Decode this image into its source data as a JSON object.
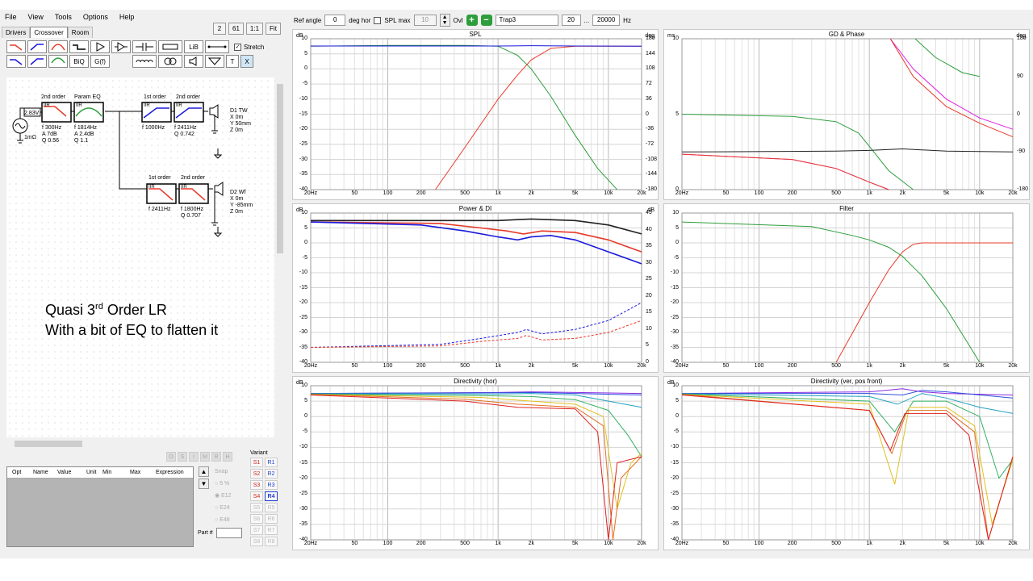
{
  "menu": [
    "File",
    "View",
    "Tools",
    "Options",
    "Help"
  ],
  "tabs": [
    "Drivers",
    "Crossover",
    "Room"
  ],
  "toolbar_right": [
    "2",
    "61",
    "1:1",
    "Fit"
  ],
  "icons": {
    "biq": "BiQ",
    "gf": "G(f)",
    "lib": "LiB",
    "t": "T",
    "x": "X"
  },
  "stretch_label": "Stretch",
  "schematic": {
    "source_voltage": "2.83V",
    "source_impedance": "1mΩ",
    "blocks": [
      {
        "header": "2nd order",
        "type": "IIR",
        "params": [
          "f  300Hz",
          "A  7dB",
          "Q  0.56"
        ]
      },
      {
        "header": "Param EQ",
        "type": "IIR",
        "params": [
          "f  1814Hz",
          "A  2.4dB",
          "Q  1.1"
        ]
      },
      {
        "header": "1st order",
        "type": "IIR",
        "params": [
          "f  1000Hz"
        ]
      },
      {
        "header": "2nd order",
        "type": "IIR",
        "params": [
          "f  2411Hz",
          "Q  0.742"
        ]
      },
      {
        "header": "1st order",
        "type": "IIR",
        "params": [
          "f  2411Hz"
        ]
      },
      {
        "header": "2nd order",
        "type": "IIR",
        "params": [
          "f  1800Hz",
          "Q  0.707"
        ]
      }
    ],
    "driver1": [
      "D1 TW",
      "X 0m",
      "Y 50mm",
      "Z 0m"
    ],
    "driver2": [
      "D2 Wf",
      "X 0m",
      "Y -85mm",
      "Z 0m"
    ]
  },
  "annotation": {
    "line1a": "Quasi 3",
    "line1sup": "rd",
    "line1b": " Order LR",
    "line2": "With a bit of EQ to flatten it"
  },
  "opt_buttons": [
    "O",
    "S",
    "I",
    "M",
    "R",
    "H"
  ],
  "table_headers": [
    "Opt",
    "Name",
    "Value",
    "Unit",
    "Min",
    "Max",
    "Expression"
  ],
  "snap": {
    "label": "Snap",
    "options": [
      "5 %",
      "E12",
      "E24",
      "E48"
    ]
  },
  "part_label": "Part #",
  "variant": {
    "label": "Variant",
    "s": [
      "S1",
      "S2",
      "S3",
      "S4",
      "S5",
      "S6",
      "S7",
      "S8"
    ],
    "r": [
      "R1",
      "R2",
      "R3",
      "R4",
      "R5",
      "R6",
      "R7",
      "R8"
    ],
    "selected": "R4"
  },
  "top_controls": {
    "ref_angle_label": "Ref angle",
    "ref_angle": "0",
    "deg_hor": "deg hor",
    "spl_max_label": "SPL max",
    "spl_max": "10",
    "ovl": "Ovl",
    "name": "Trap3",
    "fmin": "20",
    "dots": "...",
    "fmax": "20000",
    "hz": "Hz"
  },
  "x_ticks": [
    "20Hz",
    "50",
    "100",
    "200",
    "500",
    "1k",
    "2k",
    "5k",
    "10k",
    "20k"
  ],
  "colors": {
    "green": "#2e9e3c",
    "red": "#e83a2a",
    "blue": "#1a1adc",
    "black": "#222222",
    "magenta": "#e020e0",
    "grey": "#808080"
  },
  "chart_data": [
    {
      "type": "line",
      "title": "SPL",
      "ylabel_left": "dB",
      "ylabel_right": "deg",
      "ylim": [
        -40,
        10
      ],
      "yticks": [
        "10",
        "5",
        "0",
        "-5",
        "-10",
        "-15",
        "-20",
        "-25",
        "-30",
        "-35",
        "-40"
      ],
      "yticks_right": [
        "180",
        "144",
        "108",
        "72",
        "36",
        "0",
        "-36",
        "-72",
        "-108",
        "-144",
        "-180"
      ],
      "series": [
        {
          "color": "green",
          "x": [
            20,
            100,
            500,
            1000,
            1500,
            2000,
            3000,
            5000,
            8000,
            12000
          ],
          "y": [
            7.5,
            7.8,
            7.8,
            7.5,
            4.5,
            0,
            -9,
            -22,
            -33,
            -42
          ]
        },
        {
          "color": "red",
          "x": [
            270,
            500,
            1000,
            1500,
            2000,
            3000,
            5000,
            10000,
            20000
          ],
          "y": [
            -40,
            -26,
            -10,
            -2,
            3,
            6.8,
            7.5,
            7.5,
            7.5
          ]
        },
        {
          "color": "blue",
          "x": [
            20,
            1000,
            2000,
            5000,
            20000
          ],
          "y": [
            7.6,
            7.6,
            7.7,
            7.6,
            7.5
          ]
        }
      ]
    },
    {
      "type": "line",
      "title": "GD & Phase",
      "ylabel_left": "ms",
      "ylabel_right": "deg",
      "ylim": [
        -5,
        15
      ],
      "yticks": [
        "10",
        "5",
        "0"
      ],
      "yticks_right": [
        "180",
        "90",
        "0",
        "-90",
        "-180"
      ],
      "series": [
        {
          "color": "green",
          "x": [
            20,
            200,
            500,
            800,
            1100,
            1500,
            2500
          ],
          "y": [
            5,
            4.7,
            4,
            2.5,
            0,
            -2.5,
            -5
          ]
        },
        {
          "color": "green",
          "x": [
            2600,
            4000,
            7000,
            10000
          ],
          "y": [
            15,
            12.5,
            10.5,
            10
          ]
        },
        {
          "color": "black",
          "x": [
            20,
            500,
            1000,
            2000,
            5000,
            20000
          ],
          "y": [
            0,
            0.1,
            0.2,
            0.4,
            0.1,
            0
          ]
        },
        {
          "color": "magenta",
          "x": [
            20,
            200,
            500,
            1000,
            1500
          ],
          "y": [
            -0.3,
            -1,
            -2.2,
            -4,
            -5
          ]
        },
        {
          "color": "magenta",
          "x": [
            1550,
            2500,
            5000,
            10000,
            20000
          ],
          "y": [
            15,
            11,
            7,
            4.5,
            3
          ]
        },
        {
          "color": "red",
          "x": [
            20,
            200,
            500,
            1000,
            1500
          ],
          "y": [
            -0.3,
            -1,
            -2.2,
            -4,
            -5
          ]
        },
        {
          "color": "red",
          "x": [
            1550,
            2500,
            5000,
            10000,
            20000
          ],
          "y": [
            15,
            10,
            6,
            3.8,
            2
          ]
        }
      ]
    },
    {
      "type": "line",
      "title": "Power & DI",
      "ylabel_left": "dB",
      "ylabel_right": "dB",
      "ylim": [
        -40,
        10
      ],
      "yticks": [
        "10",
        "5",
        "0",
        "-5",
        "-10",
        "-15",
        "-20",
        "-25",
        "-30",
        "-35",
        "-40"
      ],
      "yticks_right": [
        "45",
        "40",
        "35",
        "30",
        "25",
        "20",
        "15",
        "10",
        "5",
        "0"
      ],
      "series": [
        {
          "color": "black",
          "x": [
            20,
            500,
            1000,
            2000,
            5000,
            10000,
            20000
          ],
          "y": [
            7.5,
            7.5,
            7.5,
            8,
            7.5,
            6,
            3
          ]
        },
        {
          "color": "red",
          "x": [
            20,
            300,
            700,
            1200,
            1700,
            2500,
            5000,
            10000,
            20000
          ],
          "y": [
            7,
            6.5,
            5,
            4,
            3,
            4,
            3.5,
            1,
            -3
          ]
        },
        {
          "color": "blue",
          "x": [
            20,
            200,
            500,
            1000,
            1500,
            2000,
            3000,
            5000,
            10000,
            20000
          ],
          "y": [
            7,
            6,
            4,
            2,
            1,
            2,
            2.5,
            1,
            -3,
            -7
          ]
        },
        {
          "color": "blue",
          "x": [
            20,
            300,
            700,
            1500,
            1800,
            2500,
            5000,
            10000,
            20000
          ],
          "y": [
            -35,
            -34,
            -32,
            -30,
            -29,
            -30.5,
            -29,
            -26,
            -20
          ]
        },
        {
          "color": "red",
          "x": [
            20,
            300,
            700,
            1500,
            1800,
            2500,
            5000,
            10000,
            20000
          ],
          "y": [
            -35,
            -34.5,
            -33,
            -32,
            -31,
            -32.5,
            -32,
            -30,
            -26
          ]
        }
      ]
    },
    {
      "type": "line",
      "title": "Filter",
      "ylim": [
        -40,
        10
      ],
      "yticks": [
        "10",
        "5",
        "0",
        "-5",
        "-10",
        "-15",
        "-20",
        "-25",
        "-30",
        "-35",
        "-40"
      ],
      "series": [
        {
          "color": "green",
          "x": [
            20,
            300,
            700,
            1000,
            1500,
            2000,
            3000,
            5000,
            10000
          ],
          "y": [
            7,
            5.5,
            2.5,
            1,
            -1.5,
            -4.5,
            -11,
            -22,
            -40
          ]
        },
        {
          "color": "red",
          "x": [
            500,
            1000,
            1500,
            2000,
            2500,
            3000,
            5000,
            20000
          ],
          "y": [
            -40,
            -20,
            -9,
            -3,
            -0.5,
            0,
            0,
            0
          ]
        }
      ]
    },
    {
      "type": "line",
      "title": "Directivity (hor)",
      "ylabel_left": "dB",
      "ylim": [
        -40,
        10
      ],
      "yticks": [
        "10",
        "5",
        "0",
        "-5",
        "-10",
        "-15",
        "-20",
        "-25",
        "-30",
        "-35",
        "-40"
      ],
      "series": [
        {
          "color": "#8a2be2",
          "x": [
            20,
            1000,
            2000,
            5000,
            20000
          ],
          "y": [
            7.5,
            7.8,
            8,
            7.8,
            7.5
          ]
        },
        {
          "color": "#3050e0",
          "x": [
            20,
            1000,
            2000,
            5000,
            20000
          ],
          "y": [
            7.5,
            7.7,
            7.8,
            7.5,
            7
          ]
        },
        {
          "color": "#20a0c0",
          "x": [
            20,
            1000,
            2000,
            5000,
            10000,
            20000
          ],
          "y": [
            7.4,
            7.3,
            7.5,
            7,
            5,
            3
          ]
        },
        {
          "color": "#30b060",
          "x": [
            20,
            700,
            2000,
            5000,
            10000,
            15000,
            20000
          ],
          "y": [
            7.3,
            6.8,
            6.5,
            5.5,
            2,
            -6,
            -13
          ]
        },
        {
          "color": "#e0c020",
          "x": [
            20,
            700,
            2000,
            5000,
            9000,
            12000,
            16000,
            20000
          ],
          "y": [
            7.2,
            6.2,
            5,
            4,
            0,
            -30,
            -15,
            -12
          ]
        },
        {
          "color": "#e07020",
          "x": [
            20,
            500,
            1500,
            5000,
            9000,
            11000,
            13000,
            20000
          ],
          "y": [
            7.2,
            5.6,
            4,
            3,
            -3,
            -40,
            -20,
            -13
          ]
        },
        {
          "color": "#e02020",
          "x": [
            20,
            500,
            1500,
            5000,
            8000,
            10000,
            12000,
            20000
          ],
          "y": [
            7,
            5,
            3,
            2.5,
            -5,
            -40,
            -15,
            -13
          ]
        }
      ]
    },
    {
      "type": "line",
      "title": "Directivity (ver, pos front)",
      "ylabel_left": "dB",
      "ylim": [
        -40,
        10
      ],
      "yticks": [
        "10",
        "5",
        "0",
        "-5",
        "-10",
        "-15",
        "-20",
        "-25",
        "-30",
        "-35",
        "-40"
      ],
      "series": [
        {
          "color": "#8a2be2",
          "x": [
            20,
            1000,
            2000,
            3000,
            5000,
            20000
          ],
          "y": [
            7.5,
            8,
            9,
            8,
            7.5,
            7
          ]
        },
        {
          "color": "#3050e0",
          "x": [
            20,
            1000,
            2000,
            3000,
            5000,
            20000
          ],
          "y": [
            7.5,
            7.5,
            7,
            8.5,
            8,
            6
          ]
        },
        {
          "color": "#20a0c0",
          "x": [
            20,
            1000,
            1800,
            3000,
            5000,
            10000,
            20000
          ],
          "y": [
            7.4,
            6.5,
            4,
            7.5,
            6,
            3,
            1
          ]
        },
        {
          "color": "#30b060",
          "x": [
            20,
            1000,
            1700,
            2500,
            5000,
            10000,
            15000,
            20000
          ],
          "y": [
            7.3,
            5,
            -5,
            5,
            5,
            0,
            -20,
            -14
          ]
        },
        {
          "color": "#e0c020",
          "x": [
            20,
            1000,
            1700,
            2300,
            5000,
            9000,
            13000,
            20000
          ],
          "y": [
            7.2,
            4,
            -22,
            3,
            3,
            -3,
            -35,
            -14
          ]
        },
        {
          "color": "#e07020",
          "x": [
            20,
            1000,
            1600,
            2200,
            5000,
            9000,
            12000,
            20000
          ],
          "y": [
            7.2,
            2,
            -12,
            2,
            2,
            -5,
            -40,
            -13
          ]
        },
        {
          "color": "#e02020",
          "x": [
            20,
            1000,
            1550,
            2100,
            5000,
            8000,
            12000,
            20000
          ],
          "y": [
            7,
            2,
            -11,
            1,
            1,
            -6,
            -40,
            -13
          ]
        }
      ]
    }
  ]
}
